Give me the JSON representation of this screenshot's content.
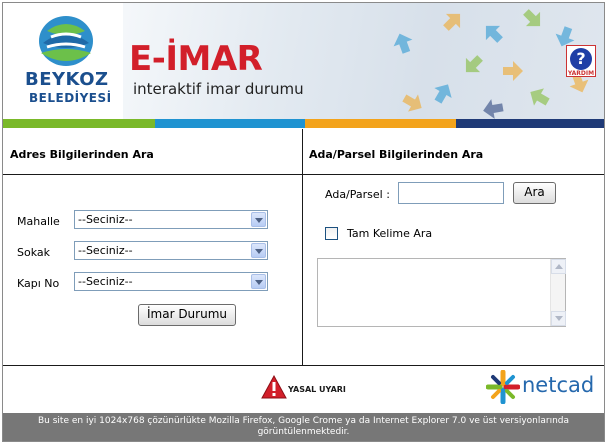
{
  "header": {
    "logo_line1": "BEYKOZ",
    "logo_line2": "BELEDİYESİ",
    "app_title": "E-İMAR",
    "app_subtitle": "interaktif imar durumu",
    "help_label": "YARDIM",
    "help_icon": "question-icon"
  },
  "colors": {
    "title_red": "#d21f2a",
    "brand_blue": "#1b4f8e",
    "strip": [
      "#7ab929",
      "#1f93d1",
      "#f3a31b",
      "#1f3a77"
    ]
  },
  "address_search": {
    "title": "Adres Bilgilerinden Ara",
    "fields": [
      {
        "label": "Mahalle",
        "value": "--Seciniz--"
      },
      {
        "label": "Sokak",
        "value": "--Seciniz--"
      },
      {
        "label": "Kapı No",
        "value": "--Seciniz--"
      }
    ],
    "submit_label": "İmar Durumu"
  },
  "parcel_search": {
    "title": "Ada/Parsel Bilgilerinden Ara",
    "field_label": "Ada/Parsel :",
    "field_value": "",
    "search_label": "Ara",
    "exact_match_label": "Tam Kelime Ara",
    "exact_match_checked": false,
    "results_text": ""
  },
  "footer": {
    "legal_label": "YASAL UYARI",
    "netcad_label": "netcad",
    "browser_notice": "Bu site en iyi 1024x768 çözünürlükte Mozilla Firefox, Google Crome ya da Internet Explorer 7.0 ve üst versiyonlarında görüntülenmektedir."
  }
}
